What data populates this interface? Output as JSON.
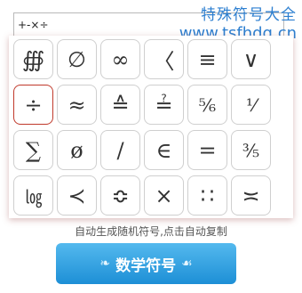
{
  "input": {
    "value": "+-×÷"
  },
  "watermark": {
    "name": "特殊符号大全",
    "url": "www.tsfhdq.cn"
  },
  "symbols": [
    "∰",
    "∅",
    "∞",
    "〈",
    "≡",
    "∨",
    "÷",
    "≈",
    "≙",
    "≟",
    "⅚",
    "⅟",
    "∑",
    "ø",
    "∕",
    "∈",
    "=",
    "⅗",
    "㏒",
    "≺",
    "≎",
    "×",
    "∷",
    "≍"
  ],
  "selected_index": 6,
  "caption": "自动生成随机符号,点击自动复制",
  "button": {
    "label": "数学符号",
    "left_ornament": "❧",
    "right_ornament": "☙"
  },
  "colors": {
    "accent": "#2d7fd0",
    "selected_border": "#c0392b",
    "button": "#1d8fd6"
  }
}
